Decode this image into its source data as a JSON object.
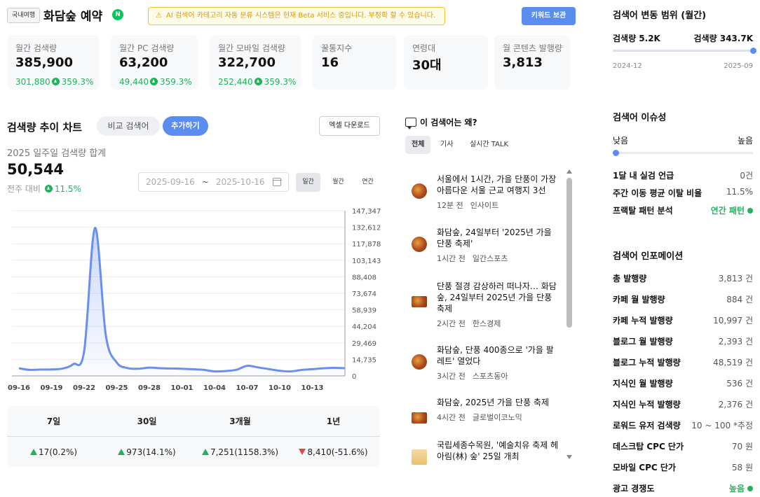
{
  "header": {
    "category_badge": "국내여행",
    "keyword": "화담숲 예약",
    "naver_badge": "N",
    "beta_notice_icon": "⚠",
    "beta_notice": "AI 검색어 카테고리 자동 분류 시스템은 현재 Beta 서비스 중입니다. 부정확 할 수 있습니다.",
    "keep_button": "키워드 보관"
  },
  "stats": [
    {
      "label": "월간 검색량",
      "value": "385,900",
      "sub_value": "301,880",
      "sub_pct": "359.3%"
    },
    {
      "label": "월간 PC 검색량",
      "value": "63,200",
      "sub_value": "49,440",
      "sub_pct": "359.3%"
    },
    {
      "label": "월간 모바일 검색량",
      "value": "322,700",
      "sub_value": "252,440",
      "sub_pct": "359.3%"
    },
    {
      "label": "꿀통지수",
      "value": "16"
    },
    {
      "label": "연령대",
      "value": "30대"
    },
    {
      "label": "월 콘텐츠 발행량",
      "value": "3,813"
    }
  ],
  "trend": {
    "title": "검색량 추이 차트",
    "compare_button": "비교 검색어",
    "add_button": "추가하기",
    "excel_button": "엑셀 다운로드",
    "period_label": "2025 일주일 검색량 합계",
    "total": "50,544",
    "wow_label": "전주 대비",
    "wow_pct": "11.5%",
    "date_from": "2025-09-16",
    "date_sep": "~",
    "date_to": "2025-10-16",
    "range_tabs": [
      "일간",
      "월간",
      "연간"
    ]
  },
  "chart_data": {
    "type": "area",
    "color": "#6b8ff0",
    "y_axis_ticks": [
      "147,347",
      "132,612",
      "117,878",
      "103,143",
      "88,408",
      "73,674",
      "58,939",
      "44,204",
      "29,469",
      "14,735",
      "0"
    ],
    "ylim": [
      0,
      147347
    ],
    "x_tick_labels": [
      "09-16",
      "09-19",
      "09-22",
      "09-25",
      "09-28",
      "10-01",
      "10-04",
      "10-07",
      "10-10",
      "10-13"
    ],
    "x": [
      "09-16",
      "09-17",
      "09-18",
      "09-19",
      "09-20",
      "09-21",
      "09-22",
      "09-23",
      "09-24",
      "09-25",
      "09-26",
      "09-27",
      "09-28",
      "09-29",
      "09-30",
      "10-01",
      "10-02",
      "10-03",
      "10-04",
      "10-05",
      "10-06",
      "10-07",
      "10-08",
      "10-09",
      "10-10",
      "10-11",
      "10-12",
      "10-13",
      "10-14",
      "10-15",
      "10-16"
    ],
    "values": [
      6800,
      5400,
      5700,
      5800,
      6500,
      10500,
      22000,
      132000,
      36000,
      12000,
      7000,
      6400,
      7400,
      6900,
      6600,
      6400,
      5900,
      5400,
      4000,
      4300,
      5400,
      9000,
      7600,
      6100,
      4600,
      4000,
      5300,
      6000,
      6800,
      7200,
      6900
    ],
    "grid": true
  },
  "summary": {
    "headers": [
      "7일",
      "30일",
      "3개월",
      "1년"
    ],
    "values": [
      {
        "text": "17(0.2%)",
        "dir": "up"
      },
      {
        "text": "973(14.1%)",
        "dir": "up"
      },
      {
        "text": "7,251(1158.3%)",
        "dir": "up"
      },
      {
        "text": "8,410(-51.6%)",
        "dir": "down"
      }
    ]
  },
  "news": {
    "title": "이 검색어는 왜?",
    "tabs": [
      "전체",
      "기사",
      "실시간 TALK"
    ],
    "items": [
      {
        "headline": "서울에서 1시간, 가을 단풍이 가장 아름다운 서울 근교 여행지 3선",
        "time": "12분 전",
        "source": "인사이트"
      },
      {
        "headline": "화담숲, 24일부터 '2025년 가을 단풍 축제'",
        "time": "1시간 전",
        "source": "일간스포츠"
      },
      {
        "headline": "단풍 절경 감상하러 떠나자… 화담숲, 24일부터 2025년 가을 단풍 축제",
        "time": "2시간 전",
        "source": "한스경제"
      },
      {
        "headline": "화담숲, 단풍 400종으로 '가을 팔레트' 열었다",
        "time": "3시간 전",
        "source": "스포츠동아"
      },
      {
        "headline": "화담숲, 2025년 가을 단풍 축제",
        "time": "4시간 전",
        "source": "글로벌이코노믹"
      },
      {
        "headline": "국립세종수목원, '예술치유 축제 헤아림(林) 숲' 25일 개최",
        "time": "",
        "source": ""
      }
    ]
  },
  "range_panel": {
    "title": "검색어 변동 범위 (월간)",
    "min_label": "검색량 5.2K",
    "max_label": "검색량 343.7K",
    "start_date": "2024-12",
    "end_date": "2025-09",
    "position": 1.0
  },
  "issue_panel": {
    "title": "검색어 이슈성",
    "low": "낮음",
    "high": "높음",
    "level": 0.02,
    "rows": [
      {
        "k": "1달 내 실검 언급",
        "v": "0건"
      },
      {
        "k": "주간 이동 평균 이탈 비율",
        "v": "11.5%"
      },
      {
        "k": "프랙탈 패턴 분석",
        "v": "연간 패턴",
        "green": true
      }
    ]
  },
  "info_panel": {
    "title": "검색어 인포메이션",
    "rows": [
      {
        "k": "총 발행량",
        "v": "3,813 건"
      },
      {
        "k": "카페 월 발행량",
        "v": "884 건"
      },
      {
        "k": "카페 누적 발행량",
        "v": "10,997 건"
      },
      {
        "k": "블로그 월 발행량",
        "v": "2,393 건"
      },
      {
        "k": "블로그 누적 발행량",
        "v": "48,519 건"
      },
      {
        "k": "지식인 월 발행량",
        "v": "536 건"
      },
      {
        "k": "지식인 누적 발행량",
        "v": "2,376 건"
      },
      {
        "k": "로워드 유저 검색량",
        "v": "10 ~ 100 *추정"
      },
      {
        "k": "데스크탑 CPC 단가",
        "v": "70 원"
      },
      {
        "k": "모바일 CPC 단가",
        "v": "58 원"
      },
      {
        "k": "광고 경쟁도",
        "v": "높음",
        "green": true
      }
    ]
  }
}
